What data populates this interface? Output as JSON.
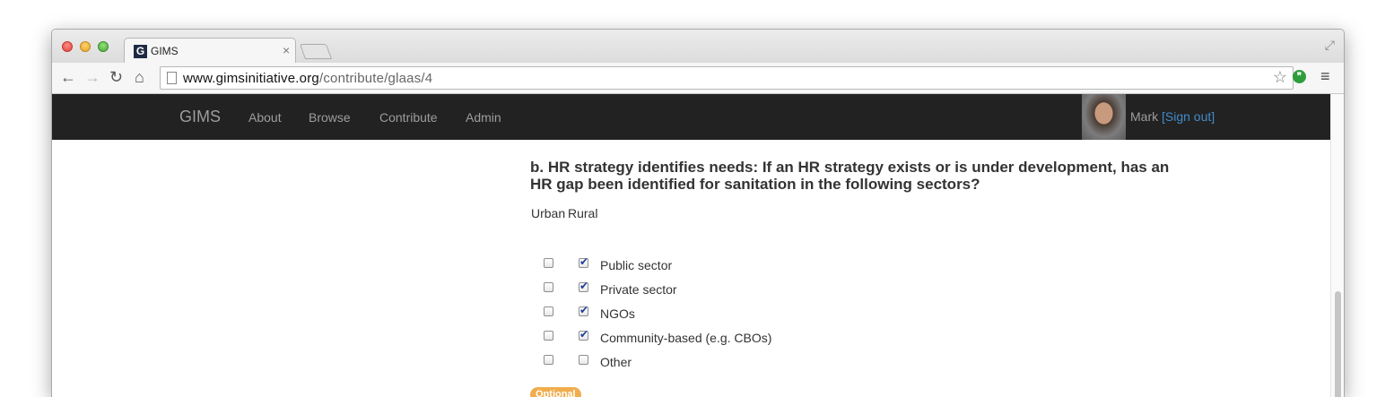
{
  "browser": {
    "tab_title": "GIMS",
    "tab_favicon_letter": "G",
    "url_host": "www.gimsinitiative.org",
    "url_path": "/contribute/glaas/4"
  },
  "navbar": {
    "brand": "GIMS",
    "links": [
      "About",
      "Browse",
      "Contribute",
      "Admin"
    ],
    "user_name": "Mark",
    "sign_out": "[Sign out]"
  },
  "question": {
    "text": "b. HR strategy identifies needs: If an HR strategy exists or is under development, has an HR gap been identified for sanitation in the following sectors?",
    "columns": [
      "Urban",
      "Rural"
    ],
    "rows": [
      {
        "label": "Public sector",
        "urban": false,
        "rural": true
      },
      {
        "label": "Private sector",
        "urban": false,
        "rural": true
      },
      {
        "label": "NGOs",
        "urban": false,
        "rural": true
      },
      {
        "label": "Community-based (e.g. CBOs)",
        "urban": false,
        "rural": true
      },
      {
        "label": "Other",
        "urban": false,
        "rural": false
      }
    ],
    "badge": "Optional"
  },
  "colors": {
    "navbar_bg": "#222222",
    "link_blue": "#428bca",
    "badge_orange": "#f0ad4e"
  }
}
